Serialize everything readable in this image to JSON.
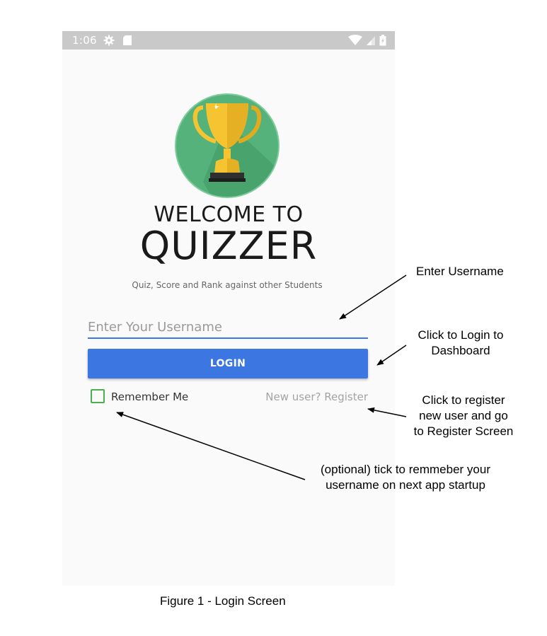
{
  "status_bar": {
    "time": "1:06",
    "icons": [
      "settings-gear-icon",
      "sd-card-icon",
      "wifi-icon",
      "cellular-signal-icon",
      "battery-icon"
    ]
  },
  "app": {
    "logo_icon": "trophy-icon",
    "welcome_title": "WELCOME TO",
    "app_name": "QUIZZER",
    "tagline": "Quiz, Score and Rank against other Students",
    "username_placeholder": "Enter Your Username",
    "username_value": "",
    "login_label": "LOGIN",
    "remember_label": "Remember Me",
    "remember_checked": false,
    "register_link": "New user? Register"
  },
  "annotations": {
    "username": "Enter Username",
    "login_line1": "Click to Login to",
    "login_line2": "Dashboard",
    "register_line1": "Click to register",
    "register_line2": "new user and go",
    "register_line3": "to Register Screen",
    "remember_line1": "(optional) tick to remmeber your",
    "remember_line2": "username on next app startup"
  },
  "caption": "Figure 1 - Login Screen",
  "colors": {
    "status_bar": "#c9c9c9",
    "primary_button": "#3c76e0",
    "logo_circle": "#55b27a",
    "trophy_gold": "#f6c431",
    "checkbox_border": "#4caf50"
  }
}
